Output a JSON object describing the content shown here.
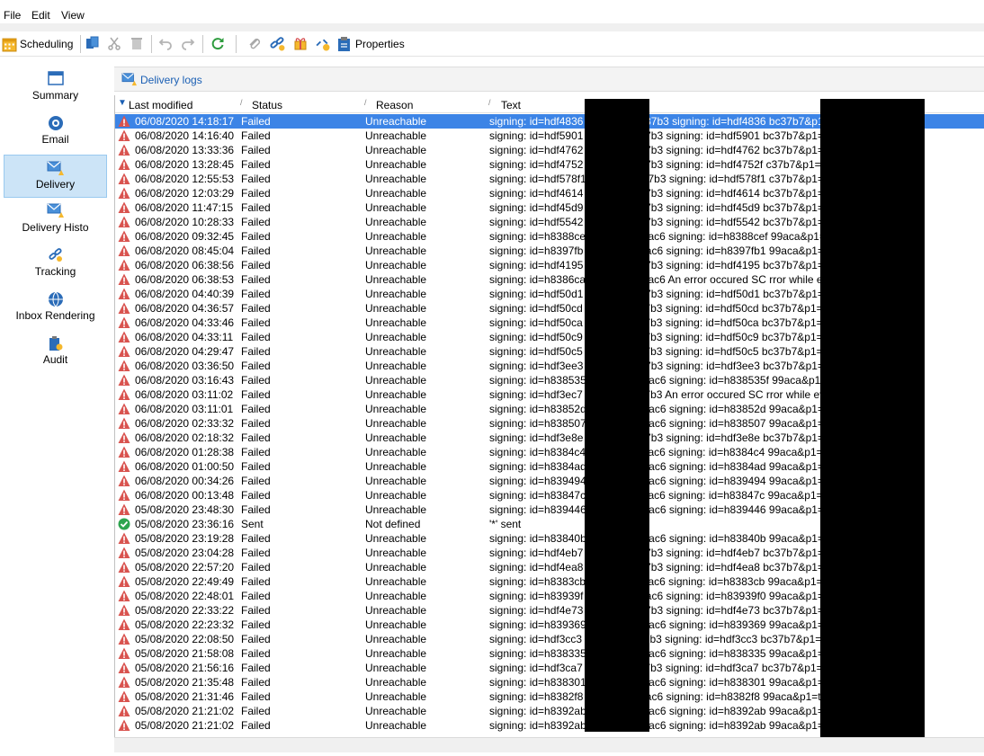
{
  "menu": {
    "file": "File",
    "edit": "Edit",
    "view": "View"
  },
  "toolbar": {
    "scheduling": "Scheduling",
    "properties": "Properties"
  },
  "nav": [
    {
      "label": "Summary",
      "icon": "summary-icon"
    },
    {
      "label": "Email",
      "icon": "email-icon"
    },
    {
      "label": "Delivery",
      "icon": "delivery-icon"
    },
    {
      "label": "Delivery Histo",
      "icon": "delivery-history-icon"
    },
    {
      "label": "Tracking",
      "icon": "tracking-icon"
    },
    {
      "label": "Inbox Rendering",
      "icon": "inbox-rendering-icon"
    },
    {
      "label": "Audit",
      "icon": "audit-icon"
    }
  ],
  "panel": {
    "title": "Delivery logs"
  },
  "columns": {
    "modified": "Last modified",
    "status": "Status",
    "reason": "Reason",
    "text": "Text"
  },
  "colors": {
    "selection": "#3c84e6",
    "nav_selected": "#cce4f7",
    "error": "#d9534f",
    "success": "#2ea44f",
    "link": "#1a5fb4"
  },
  "rows": [
    {
      "date": "06/08/2020 14:18:17",
      "status": "Failed",
      "reason": "Unreachable",
      "text": "signing: id=hdf4836                    b2%2C16bc37b3 signing: id=hdf4836                                        bc37b7&p1=",
      "icon": "error"
    },
    {
      "date": "06/08/2020 14:16:40",
      "status": "Failed",
      "reason": "Unreachable",
      "text": "signing: id=hdf5901                   2%2C16bc37b3 signing: id=hdf5901                                        bc37b7&p1=",
      "icon": "error"
    },
    {
      "date": "06/08/2020 13:33:36",
      "status": "Failed",
      "reason": "Unreachable",
      "text": "signing: id=hdf4762                   2%2C16bc37b3 signing: id=hdf4762                                        bc37b7&p1=",
      "icon": "error"
    },
    {
      "date": "06/08/2020 13:28:45",
      "status": "Failed",
      "reason": "Unreachable",
      "text": "signing: id=hdf4752                   2%2C16bc37b3 signing: id=hdf4752f                                       c37b7&p1=t",
      "icon": "error"
    },
    {
      "date": "06/08/2020 12:55:53",
      "status": "Failed",
      "reason": "Unreachable",
      "text": "signing: id=hdf578f1                  2%2C16bc37b3 signing: id=hdf578f1                                       c37b7&p1=t",
      "icon": "error"
    },
    {
      "date": "06/08/2020 12:03:29",
      "status": "Failed",
      "reason": "Unreachable",
      "text": "signing: id=hdf4614                   2%2C16bc37b3 signing: id=hdf4614                                        bc37b7&p1=",
      "icon": "error"
    },
    {
      "date": "06/08/2020 11:47:15",
      "status": "Failed",
      "reason": "Unreachable",
      "text": "signing: id=hdf45d9                   2%2C16bc37b3 signing: id=hdf45d9                                        bc37b7&p1=",
      "icon": "error"
    },
    {
      "date": "06/08/2020 10:28:33",
      "status": "Failed",
      "reason": "Unreachable",
      "text": "signing: id=hdf5542                   2%2C16bc37b3 signing: id=hdf5542                                        bc37b7&p1=",
      "icon": "error"
    },
    {
      "date": "06/08/2020 09:32:45",
      "status": "Failed",
      "reason": "Unreachable",
      "text": "signing: id=h8388ce                   5%2C17099ac6 signing: id=h8388cef                                       99aca&p1=t",
      "icon": "error"
    },
    {
      "date": "06/08/2020 08:45:04",
      "status": "Failed",
      "reason": "Unreachable",
      "text": "signing: id=h8397fb                   5%2C17099ac6 signing: id=h8397fb1                                       99aca&p1=t",
      "icon": "error"
    },
    {
      "date": "06/08/2020 06:38:56",
      "status": "Failed",
      "reason": "Unreachable",
      "text": "signing: id=hdf4195                   2%2C16bc37b3 signing: id=hdf4195                                        bc37b7&p1=",
      "icon": "error"
    },
    {
      "date": "06/08/2020 06:38:53",
      "status": "Failed",
      "reason": "Unreachable",
      "text": "signing: id=h8386ca                   5%2C17099ac6 An error occured SC                                        rror while eva",
      "icon": "error"
    },
    {
      "date": "06/08/2020 04:40:39",
      "status": "Failed",
      "reason": "Unreachable",
      "text": "signing: id=hdf50d1                   2%2C16bc37b3 signing: id=hdf50d1                                        bc37b7&p1=",
      "icon": "error"
    },
    {
      "date": "06/08/2020 04:36:57",
      "status": "Failed",
      "reason": "Unreachable",
      "text": "signing: id=hdf50cd                   2%2C16bc37b3 signing: id=hdf50cd                                        bc37b7&p1=",
      "icon": "error"
    },
    {
      "date": "06/08/2020 04:33:46",
      "status": "Failed",
      "reason": "Unreachable",
      "text": "signing: id=hdf50ca                   2%2C16bc37b3 signing: id=hdf50ca                                        bc37b7&p1=",
      "icon": "error"
    },
    {
      "date": "06/08/2020 04:33:11",
      "status": "Failed",
      "reason": "Unreachable",
      "text": "signing: id=hdf50c9                   2%2C16bc37b3 signing: id=hdf50c9                                        bc37b7&p1=",
      "icon": "error"
    },
    {
      "date": "06/08/2020 04:29:47",
      "status": "Failed",
      "reason": "Unreachable",
      "text": "signing: id=hdf50c5                   2%2C16bc37b3 signing: id=hdf50c5                                        bc37b7&p1=",
      "icon": "error"
    },
    {
      "date": "06/08/2020 03:36:50",
      "status": "Failed",
      "reason": "Unreachable",
      "text": "signing: id=hdf3ee3                   2%2C16bc37b3 signing: id=hdf3ee3                                        bc37b7&p1=",
      "icon": "error"
    },
    {
      "date": "06/08/2020 03:16:43",
      "status": "Failed",
      "reason": "Unreachable",
      "text": "signing: id=h838535                   5%2C17099ac6 signing: id=h838535f                                       99aca&p1=t",
      "icon": "error"
    },
    {
      "date": "06/08/2020 03:11:02",
      "status": "Failed",
      "reason": "Unreachable",
      "text": "signing: id=hdf3ec7                   2%2C16bc37b3 An error occured SC                                        rror while eva",
      "icon": "error"
    },
    {
      "date": "06/08/2020 03:11:01",
      "status": "Failed",
      "reason": "Unreachable",
      "text": "signing: id=h83852d                   5%2C17099ac6 signing: id=h83852d                                        99aca&p1=t",
      "icon": "error"
    },
    {
      "date": "06/08/2020 02:33:32",
      "status": "Failed",
      "reason": "Unreachable",
      "text": "signing: id=h838507                   5%2C17099ac6 signing: id=h838507                                        99aca&p1=t",
      "icon": "error"
    },
    {
      "date": "06/08/2020 02:18:32",
      "status": "Failed",
      "reason": "Unreachable",
      "text": "signing: id=hdf3e8e                   2%2C16bc37b3 signing: id=hdf3e8e                                        bc37b7&p1=",
      "icon": "error"
    },
    {
      "date": "06/08/2020 01:28:38",
      "status": "Failed",
      "reason": "Unreachable",
      "text": "signing: id=h8384c4                   5%2C17099ac6 signing: id=h8384c4                                        99aca&p1=t",
      "icon": "error"
    },
    {
      "date": "06/08/2020 01:00:50",
      "status": "Failed",
      "reason": "Unreachable",
      "text": "signing: id=h8384ad                   5%2C17099ac6 signing: id=h8384ad                                        99aca&p1=t",
      "icon": "error"
    },
    {
      "date": "06/08/2020 00:34:26",
      "status": "Failed",
      "reason": "Unreachable",
      "text": "signing: id=h839494                   5%2C17099ac6 signing: id=h839494                                        99aca&p1=t",
      "icon": "error"
    },
    {
      "date": "06/08/2020 00:13:48",
      "status": "Failed",
      "reason": "Unreachable",
      "text": "signing: id=h83847c                   5%2C17099ac6 signing: id=h83847c                                        99aca&p1=t",
      "icon": "error"
    },
    {
      "date": "05/08/2020 23:48:30",
      "status": "Failed",
      "reason": "Unreachable",
      "text": "signing: id=h839446                   5%2C17099ac6 signing: id=h839446                                        99aca&p1=t",
      "icon": "error"
    },
    {
      "date": "05/08/2020 23:36:16",
      "status": "Sent",
      "reason": "Not defined",
      "text": "'*' sent",
      "icon": "success"
    },
    {
      "date": "05/08/2020 23:19:28",
      "status": "Failed",
      "reason": "Unreachable",
      "text": "signing: id=h83840b                   5%2C17099ac6 signing: id=h83840b                                        99aca&p1=t",
      "icon": "error"
    },
    {
      "date": "05/08/2020 23:04:28",
      "status": "Failed",
      "reason": "Unreachable",
      "text": "signing: id=hdf4eb7                   2%2C16bc37b3 signing: id=hdf4eb7                                        bc37b7&p1=",
      "icon": "error"
    },
    {
      "date": "05/08/2020 22:57:20",
      "status": "Failed",
      "reason": "Unreachable",
      "text": "signing: id=hdf4ea8                   2%2C16bc37b3 signing: id=hdf4ea8                                        bc37b7&p1=",
      "icon": "error"
    },
    {
      "date": "05/08/2020 22:49:49",
      "status": "Failed",
      "reason": "Unreachable",
      "text": "signing: id=h8383cb                   5%2C17099ac6 signing: id=h8383cb                                        99aca&p1=t",
      "icon": "error"
    },
    {
      "date": "05/08/2020 22:48:01",
      "status": "Failed",
      "reason": "Unreachable",
      "text": "signing: id=h83939f                   5%2C17099ac6 signing: id=h83939f0                                       99aca&p1=t",
      "icon": "error"
    },
    {
      "date": "05/08/2020 22:33:22",
      "status": "Failed",
      "reason": "Unreachable",
      "text": "signing: id=hdf4e73                   2%2C16bc37b3 signing: id=hdf4e73                                        bc37b7&p1=",
      "icon": "error"
    },
    {
      "date": "05/08/2020 22:23:32",
      "status": "Failed",
      "reason": "Unreachable",
      "text": "signing: id=h839369                   5%2C17099ac6 signing: id=h839369                                        99aca&p1=t",
      "icon": "error"
    },
    {
      "date": "05/08/2020 22:08:50",
      "status": "Failed",
      "reason": "Unreachable",
      "text": "signing: id=hdf3cc3                   2%2C16bc37b3 signing: id=hdf3cc3                                        bc37b7&p1=",
      "icon": "error"
    },
    {
      "date": "05/08/2020 21:58:08",
      "status": "Failed",
      "reason": "Unreachable",
      "text": "signing: id=h838335                   5%2C17099ac6 signing: id=h838335                                        99aca&p1=t",
      "icon": "error"
    },
    {
      "date": "05/08/2020 21:56:16",
      "status": "Failed",
      "reason": "Unreachable",
      "text": "signing: id=hdf3ca7                   2%2C16bc37b3 signing: id=hdf3ca7                                        bc37b7&p1=",
      "icon": "error"
    },
    {
      "date": "05/08/2020 21:35:48",
      "status": "Failed",
      "reason": "Unreachable",
      "text": "signing: id=h838301                   5%2C17099ac6 signing: id=h838301                                        99aca&p1=t",
      "icon": "error"
    },
    {
      "date": "05/08/2020 21:31:46",
      "status": "Failed",
      "reason": "Unreachable",
      "text": "signing: id=h8382f8                   5%2C17099ac6 signing: id=h8382f8                                        99aca&p1=tr",
      "icon": "error"
    },
    {
      "date": "05/08/2020 21:21:02",
      "status": "Failed",
      "reason": "Unreachable",
      "text": "signing: id=h8392ab                   5%2C17099ac6 signing: id=h8392ab                                        99aca&p1=t",
      "icon": "error"
    },
    {
      "date": "05/08/2020 21:21:02",
      "status": "Failed",
      "reason": "Unreachable",
      "text": "signing: id=h8392ab                   5%2C17099ac6 signing: id=h8392ab                                        99aca&p1=t",
      "icon": "error"
    }
  ]
}
